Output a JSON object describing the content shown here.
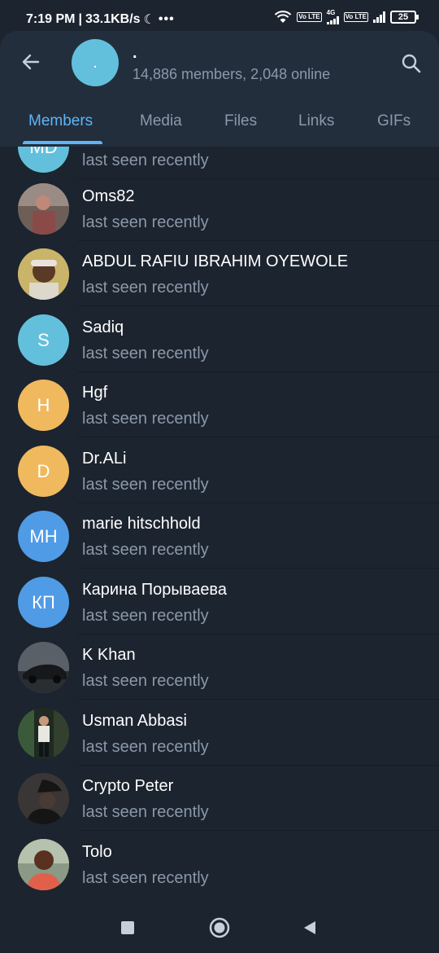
{
  "status_bar": {
    "time": "7:19 PM",
    "separator": "|",
    "speed": "33.1KB/s",
    "moon_icon": "☾",
    "dots": "•••",
    "volte1": "Vo LTE",
    "net_type": "4G",
    "volte2": "Vo LTE",
    "battery": "25"
  },
  "header": {
    "title": ".",
    "subtitle": "14,886 members, 2,048 online",
    "avatar_text": "."
  },
  "tabs": [
    {
      "label": "Members",
      "active": true
    },
    {
      "label": "Media",
      "active": false
    },
    {
      "label": "Files",
      "active": false
    },
    {
      "label": "Links",
      "active": false
    },
    {
      "label": "GIFs",
      "active": false
    }
  ],
  "members": [
    {
      "name": "",
      "status": "last seen recently",
      "initials": "MD",
      "color": "#63c0dc",
      "photo": false
    },
    {
      "name": "Oms82",
      "status": "last seen recently",
      "initials": "",
      "color": "#7a6a62",
      "photo": true
    },
    {
      "name": "ABDUL RAFIU IBRAHIM OYEWOLE",
      "status": "last seen recently",
      "initials": "",
      "color": "#b8a05a",
      "photo": true
    },
    {
      "name": "Sadiq",
      "status": "last seen recently",
      "initials": "S",
      "color": "#63c0dc",
      "photo": false
    },
    {
      "name": "Hgf",
      "status": "last seen recently",
      "initials": "H",
      "color": "#f0b95e",
      "photo": false
    },
    {
      "name": "Dr.ALi",
      "status": "last seen recently",
      "initials": "D",
      "color": "#f0b95e",
      "photo": false
    },
    {
      "name": "marie hitschhold",
      "status": "last seen recently",
      "initials": "MH",
      "color": "#4f9be6",
      "photo": false
    },
    {
      "name": "Карина Порываева",
      "status": "last seen recently",
      "initials": "КП",
      "color": "#4f9be6",
      "photo": false
    },
    {
      "name": "K Khan",
      "status": "last seen recently",
      "initials": "",
      "color": "#3a4048",
      "photo": true
    },
    {
      "name": "Usman Abbasi",
      "status": "last seen recently",
      "initials": "",
      "color": "#2a3a2a",
      "photo": true
    },
    {
      "name": "Crypto Peter",
      "status": "last seen recently",
      "initials": "",
      "color": "#2c2a2a",
      "photo": true
    },
    {
      "name": "Tolo",
      "status": "last seen recently",
      "initials": "",
      "color": "#b86a4a",
      "photo": true
    }
  ],
  "icons": {
    "back": "arrow-left-icon",
    "search": "search-icon",
    "nav_recent": "square-icon",
    "nav_home": "circle-icon",
    "nav_back": "triangle-icon"
  },
  "colors": {
    "accent": "#5eb5f7",
    "header_bg": "#232e3c",
    "list_bg": "#1c242f",
    "secondary_text": "#8a98a8"
  }
}
